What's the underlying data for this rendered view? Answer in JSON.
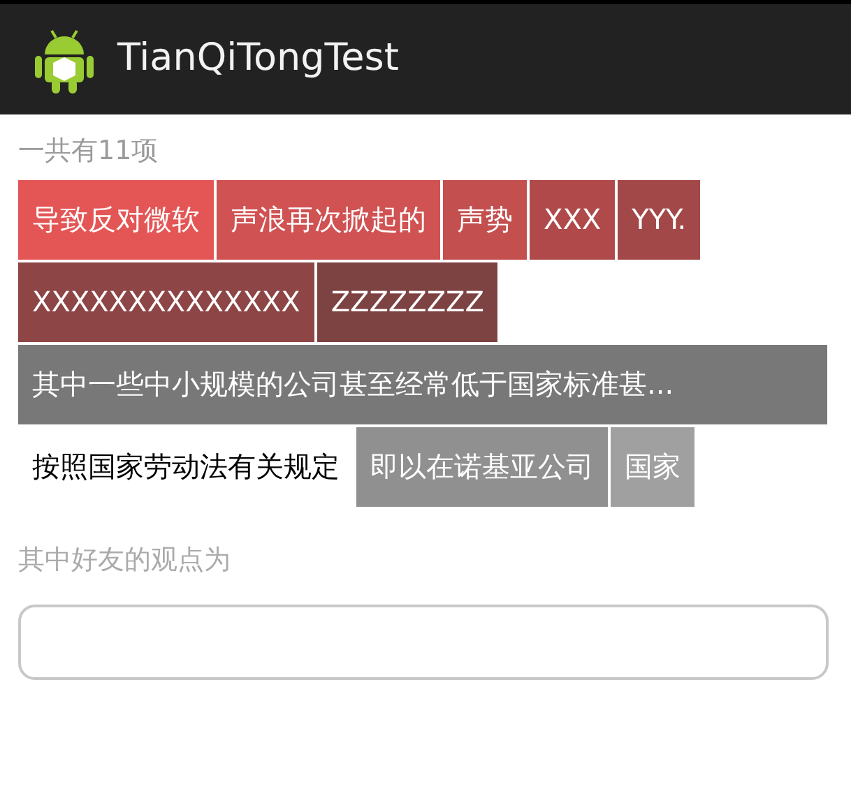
{
  "app_bar": {
    "title": "TianQiTongTest"
  },
  "count_label": "一共有11项",
  "tag_rows": [
    [
      {
        "label": "导致反对微软",
        "color": "#e45656"
      },
      {
        "label": "声浪再次掀起的",
        "color": "#d05252"
      },
      {
        "label": "声势",
        "color": "#c44f4f"
      },
      {
        "label": "XXX",
        "color": "#b04a4a"
      },
      {
        "label": "YYY.",
        "color": "#a34848"
      }
    ],
    [
      {
        "label": "XXXXXXXXXXXXXX",
        "color": "#8e4545"
      },
      {
        "label": "ZZZZZZZZ",
        "color": "#7d4242"
      }
    ],
    [
      {
        "label": "其中一些中小规模的公司甚至经常低于国家标准甚...",
        "color": "#787878"
      }
    ],
    [
      {
        "label": "按照国家劳动法有关规定",
        "color": "#ffffff"
      },
      {
        "label": "即以在诺基亚公司",
        "color": "#909090"
      },
      {
        "label": "国家",
        "color": "#a0a0a0"
      }
    ]
  ],
  "section_label": "其中好友的观点为"
}
